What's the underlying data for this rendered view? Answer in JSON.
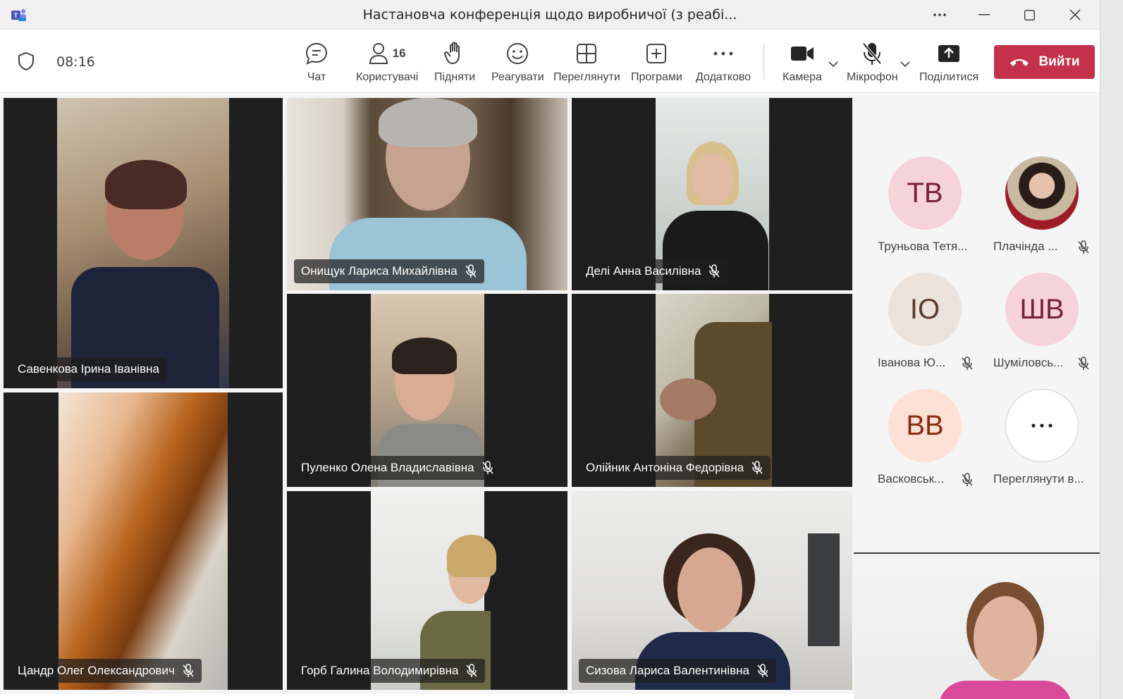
{
  "window": {
    "title": "Настановча конференція щодо виробничої (з реабі..."
  },
  "toolbar": {
    "timer": "08:16",
    "chat": "Чат",
    "people": "Користувачі",
    "people_count": "16",
    "raise": "Підняти",
    "react": "Реагувати",
    "view": "Переглянути",
    "apps": "Програми",
    "more": "Додатково",
    "camera": "Камера",
    "mic": "Мікрофон",
    "share": "Поділитися",
    "leave": "Вийти"
  },
  "tiles": [
    {
      "name": "Савенкова Ірина Іванівна",
      "muted": false
    },
    {
      "name": "Онищук Лариса Михайлівна",
      "muted": true
    },
    {
      "name": "Делі Анна Василівна",
      "muted": true
    },
    {
      "name": "Пуленко Олена Владиславівна",
      "muted": true
    },
    {
      "name": "Олійник Антоніна Федорівна",
      "muted": true
    },
    {
      "name": "Цандр Олег Олександрович",
      "muted": true
    },
    {
      "name": "Горб Галина Володимирівна",
      "muted": true
    },
    {
      "name": "Сизова Лариса Валентинівна",
      "muted": true
    }
  ],
  "roster": [
    {
      "initials": "ТВ",
      "name": "Труньова Тетя...",
      "muted": false,
      "bg": "#f6d3da",
      "fg": "#7a1f3b"
    },
    {
      "initials": "",
      "name": "Плачінда ...",
      "muted": true,
      "bg": "#c9b9a0",
      "fg": "#ffffff"
    },
    {
      "initials": "ІО",
      "name": "Іванова Ю...",
      "muted": true,
      "bg": "#ece2dc",
      "fg": "#5a3b2c"
    },
    {
      "initials": "ШВ",
      "name": "Шуміловсь...",
      "muted": true,
      "bg": "#f6d3da",
      "fg": "#7a1f3b"
    },
    {
      "initials": "ВВ",
      "name": "Васковськ...",
      "muted": true,
      "bg": "#fde0d6",
      "fg": "#8a2b10"
    },
    {
      "initials": "",
      "name": "Переглянути в...",
      "muted": false,
      "bg": "#ffffff",
      "fg": "#242424"
    }
  ],
  "colors": {
    "leave": "#c4314b",
    "tile_bg": "#1f1f1f",
    "toolbar_bg": "#ffffff",
    "titlebar_bg": "#f0f0f0"
  }
}
